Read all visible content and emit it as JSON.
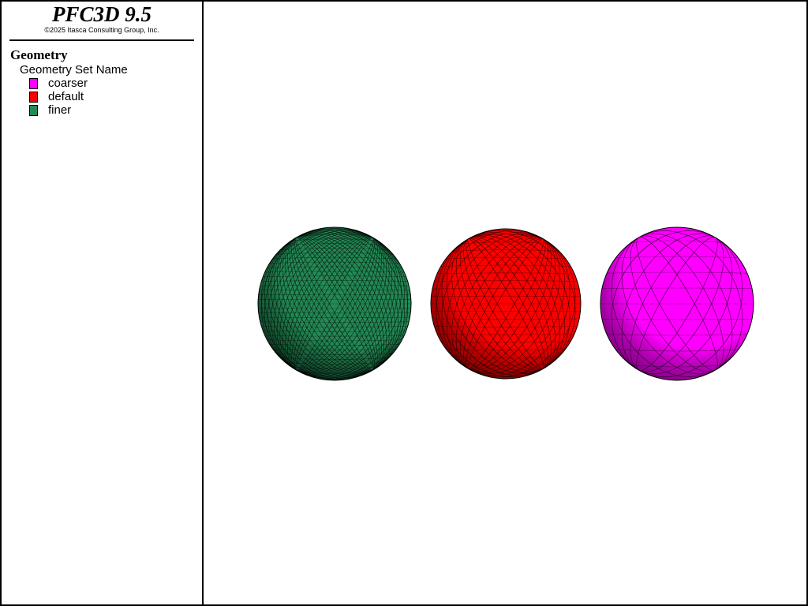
{
  "header": {
    "title": "PFC3D 9.5",
    "copyright": "©2025 Itasca Consulting Group, Inc."
  },
  "legend": {
    "heading": "Geometry",
    "subheading": "Geometry Set Name",
    "items": [
      {
        "label": "coarser",
        "color": "#ff00ff"
      },
      {
        "label": "default",
        "color": "#ff0000"
      },
      {
        "label": "finer",
        "color": "#238a55"
      }
    ]
  },
  "scene": {
    "spheres": [
      {
        "set": "finer",
        "color": "#238a55",
        "mesh": "fine"
      },
      {
        "set": "default",
        "color": "#ff0000",
        "mesh": "medium"
      },
      {
        "set": "coarser",
        "color": "#ff00ff",
        "mesh": "coarse"
      }
    ]
  }
}
